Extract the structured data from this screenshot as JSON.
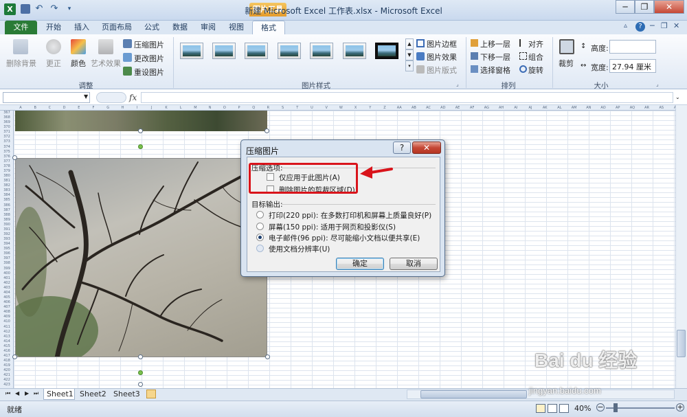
{
  "window": {
    "title": "新建 Microsoft Excel 工作表.xlsx - Microsoft Excel",
    "context_group": "图片工具",
    "minimize": "─",
    "restore": "❐",
    "close": "✕"
  },
  "tabs": {
    "file": "文件",
    "items": [
      "开始",
      "插入",
      "页面布局",
      "公式",
      "数据",
      "审阅",
      "视图",
      "格式"
    ],
    "active": "格式"
  },
  "ribbon": {
    "adjust": {
      "remove_bg": "删除背景",
      "corrections": "更正",
      "color": "颜色",
      "artistic": "艺术效果",
      "compress": "压缩图片",
      "change": "更改图片",
      "reset": "重设图片",
      "group_label": "调整"
    },
    "styles": {
      "group_label": "图片样式",
      "border": "图片边框",
      "effects": "图片效果",
      "layout": "图片版式"
    },
    "arrange": {
      "group_label": "排列",
      "bring_forward": "上移一层",
      "send_backward": "下移一层",
      "selection_pane": "选择窗格",
      "align": "对齐",
      "group": "组合",
      "rotate": "旋转"
    },
    "size": {
      "group_label": "大小",
      "crop": "裁剪",
      "height_label": "高度:",
      "height_value": "",
      "width_label": "宽度:",
      "width_value": "27.94 厘米"
    }
  },
  "formula": {
    "fx": "fx",
    "name_box": "",
    "content": ""
  },
  "columns": [
    "A",
    "B",
    "C",
    "D",
    "E",
    "F",
    "G",
    "H",
    "I",
    "J",
    "K",
    "L",
    "M",
    "N",
    "O",
    "P",
    "Q",
    "R",
    "S",
    "T",
    "U",
    "V",
    "W",
    "X",
    "Y",
    "Z",
    "AA",
    "AB",
    "AC",
    "AD",
    "AE",
    "AF",
    "AG",
    "AH",
    "AI",
    "AJ",
    "AK",
    "AL",
    "AM",
    "AN",
    "AO",
    "AP",
    "AQ",
    "AR",
    "AS",
    "AT"
  ],
  "rows_start": 367,
  "dialog": {
    "title": "压缩图片",
    "help": "?",
    "close": "✕",
    "section1": "压缩选项:",
    "opt1": "仅应用于此图片(A)",
    "opt2": "删除图片的剪裁区域(D)",
    "section2": "目标输出:",
    "radio1": "打印(220 ppi): 在多数打印机和屏幕上质量良好(P)",
    "radio2": "屏幕(150 ppi): 适用于网页和投影仪(S)",
    "radio3": "电子邮件(96 ppi): 尽可能缩小文档以便共享(E)",
    "radio4": "使用文档分辨率(U)",
    "selected_radio": 3,
    "ok": "确定",
    "cancel": "取消"
  },
  "sheets": [
    "Sheet1",
    "Sheet2",
    "Sheet3"
  ],
  "status": {
    "ready": "就绪",
    "zoom": "40%"
  },
  "watermark": {
    "line1": "Bai du 经验",
    "line2": "jingyan.baidu.com"
  },
  "colors": {
    "file_tab": "#2a7b36",
    "context": "#e59b2a",
    "highlight": "#d9141b"
  }
}
